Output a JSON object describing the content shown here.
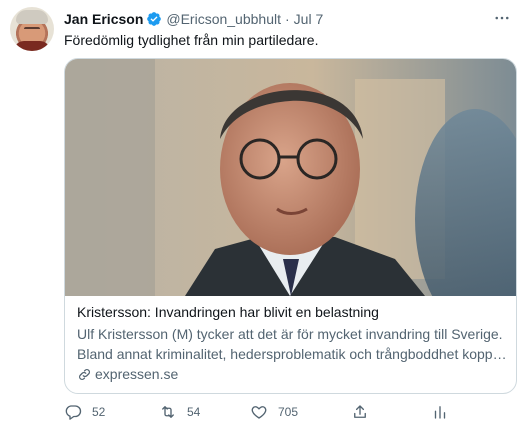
{
  "tweet": {
    "author_name": "Jan Ericson",
    "handle": "@Ericson_ubbhult",
    "separator": "·",
    "time": "Jul 7",
    "text": "Föredömlig tydlighet från min partiledare."
  },
  "card": {
    "title": "Kristersson: Invandringen har blivit en belastning",
    "description_line1": "Ulf Kristersson (M) tycker att det är för mycket invandring till Sverige.",
    "description_line2": "Bland annat kriminalitet, hedersproblematik och trångboddhet koppla...",
    "domain": "expressen.se"
  },
  "actions": {
    "replies": "52",
    "retweets": "54",
    "likes": "705"
  },
  "colors": {
    "text_primary": "#0f1419",
    "text_secondary": "#536471",
    "verified": "#1d9bf0",
    "border": "#cfd9de"
  },
  "icons": [
    "verified-badge-icon",
    "more-icon",
    "link-icon",
    "reply-icon",
    "retweet-icon",
    "like-icon",
    "share-icon",
    "analytics-icon"
  ]
}
